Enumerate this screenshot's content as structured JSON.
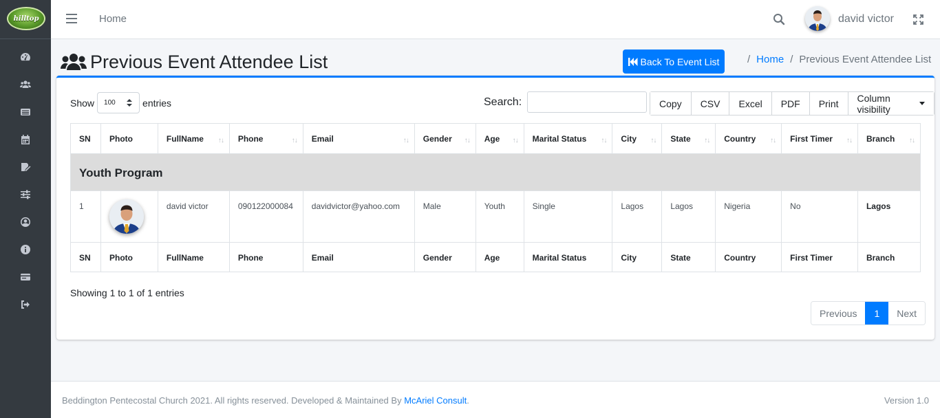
{
  "app": {
    "logo_text": "hilltop"
  },
  "topbar": {
    "home_link": "Home",
    "user_name": "david victor"
  },
  "sidebar": {
    "items": [
      {
        "icon": "dashboard-icon"
      },
      {
        "icon": "users-icon"
      },
      {
        "icon": "list-icon"
      },
      {
        "icon": "calendar-icon"
      },
      {
        "icon": "edit-icon"
      },
      {
        "icon": "sliders-icon"
      },
      {
        "icon": "user-circle-icon"
      },
      {
        "icon": "info-icon"
      },
      {
        "icon": "card-icon"
      },
      {
        "icon": "sign-out-icon"
      }
    ]
  },
  "header": {
    "title": "Previous Event Attendee List",
    "back_button": "Back To Event List",
    "breadcrumb": {
      "home": "Home",
      "current": "Previous Event Attendee List",
      "separator": "/"
    }
  },
  "controls": {
    "show_label": "Show",
    "entries_label": "entries",
    "page_length": "100",
    "search_label": "Search:",
    "buttons": [
      "Copy",
      "CSV",
      "Excel",
      "PDF",
      "Print",
      "Column visibility"
    ]
  },
  "table": {
    "columns": [
      "SN",
      "Photo",
      "FullName",
      "Phone",
      "Email",
      "Gender",
      "Age",
      "Marital Status",
      "City",
      "State",
      "Country",
      "First Timer",
      "Branch"
    ],
    "group": "Youth Program",
    "rows": [
      {
        "sn": "1",
        "fullname": "david victor",
        "phone": "090122000084",
        "email": "davidvictor@yahoo.com",
        "gender": "Male",
        "age": "Youth",
        "marital": "Single",
        "city": "Lagos",
        "state": "Lagos",
        "country": "Nigeria",
        "first_timer": "No",
        "branch": "Lagos"
      }
    ]
  },
  "pagination": {
    "info": "Showing 1 to 1 of 1 entries",
    "previous": "Previous",
    "current": "1",
    "next": "Next"
  },
  "footer": {
    "copyright": "Beddington Pentecostal Church 2021. All rights reserved. Developed & Maintained By ",
    "company": "McAriel Consult",
    "period": ".",
    "version": "Version 1.0"
  },
  "colors": {
    "primary": "#007bff",
    "sidebar": "#343a40",
    "group_row": "#dcdcdc"
  }
}
